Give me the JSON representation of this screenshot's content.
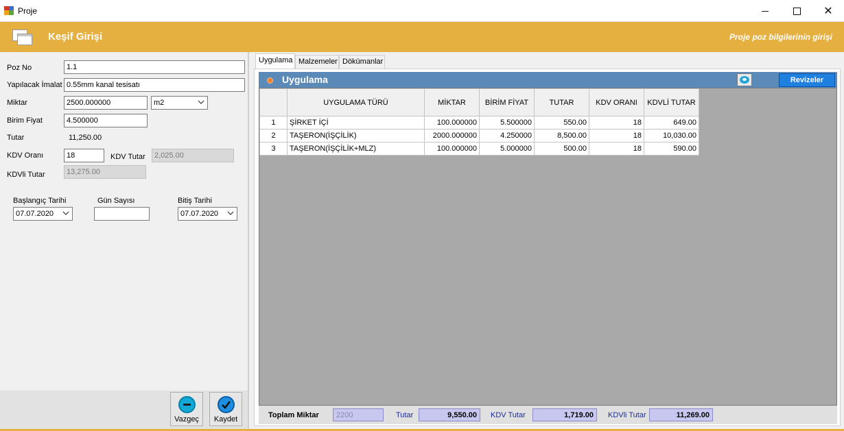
{
  "window": {
    "title": "Proje",
    "minimize": "—",
    "maximize": "□",
    "close": "✕"
  },
  "header": {
    "title": "Keşif Girişi",
    "subtitle": "Proje poz bilgilerinin girişi"
  },
  "form": {
    "poz_no_label": "Poz No",
    "poz_no_value": "1.1",
    "imalat_label": "Yapılacak İmalat",
    "imalat_value": "0.55mm kanal tesisatı",
    "miktar_label": "Miktar",
    "miktar_value": "2500.000000",
    "unit_value": "m2",
    "birim_fiyat_label": "Birim Fiyat",
    "birim_fiyat_value": "4.500000",
    "tutar_label": "Tutar",
    "tutar_value": "11,250.00",
    "kdv_orani_label": "KDV Oranı",
    "kdv_orani_value": "18",
    "kdv_tutar_label": "KDV Tutar",
    "kdv_tutar_value": "2,025.00",
    "kdvli_tutar_label": "KDVli Tutar",
    "kdvli_tutar_value": "13,275.00",
    "baslangic_label": "Başlangıç Tarihi",
    "baslangic_value": "07.07.2020",
    "gun_label": "Gün Sayısı",
    "gun_value": "",
    "bitis_label": "Bitiş Tarihi",
    "bitis_value": "07.07.2020"
  },
  "actions": {
    "cancel_label": "Vazgeç",
    "save_label": "Kaydet"
  },
  "tabs": [
    "Uygulama",
    "Malzemeler",
    "Dökümanlar"
  ],
  "panel": {
    "title": "Uygulama",
    "revisions_label": "Revizeler"
  },
  "grid": {
    "headers": [
      "UYGULAMA TÜRÜ",
      "MİKTAR",
      "BİRİM FİYAT",
      "TUTAR",
      "KDV ORANI",
      "KDVLİ TUTAR"
    ],
    "rows": [
      {
        "idx": "1",
        "type": "ŞİRKET İÇİ",
        "miktar": "100.000000",
        "birim": "5.500000",
        "tutar": "550.00",
        "kdv": "18",
        "kdvli": "649.00"
      },
      {
        "idx": "2",
        "type": "TAŞERON(İŞÇİLİK)",
        "miktar": "2000.000000",
        "birim": "4.250000",
        "tutar": "8,500.00",
        "kdv": "18",
        "kdvli": "10,030.00"
      },
      {
        "idx": "3",
        "type": "TAŞERON(İŞÇİLİK+MLZ)",
        "miktar": "100.000000",
        "birim": "5.000000",
        "tutar": "500.00",
        "kdv": "18",
        "kdvli": "590.00"
      }
    ]
  },
  "footer": {
    "toplam_label": "Toplam Miktar",
    "toplam_value": "2200",
    "tutar_label": "Tutar",
    "tutar_value": "9,550.00",
    "kdv_label": "KDV  Tutar",
    "kdv_value": "1,719.00",
    "kdvli_label": "KDVli Tutar",
    "kdvli_value": "11,269.00"
  },
  "colors": {
    "accent": "#e5b040",
    "panel_header": "#5b8ab8",
    "revisions_button": "#1f80e0",
    "footer_box": "#c7c7f0"
  },
  "icons": [
    "app-icon",
    "form-icon",
    "minus-icon",
    "check-icon",
    "eye-icon",
    "chevron-down-icon",
    "orange-dot-icon"
  ]
}
